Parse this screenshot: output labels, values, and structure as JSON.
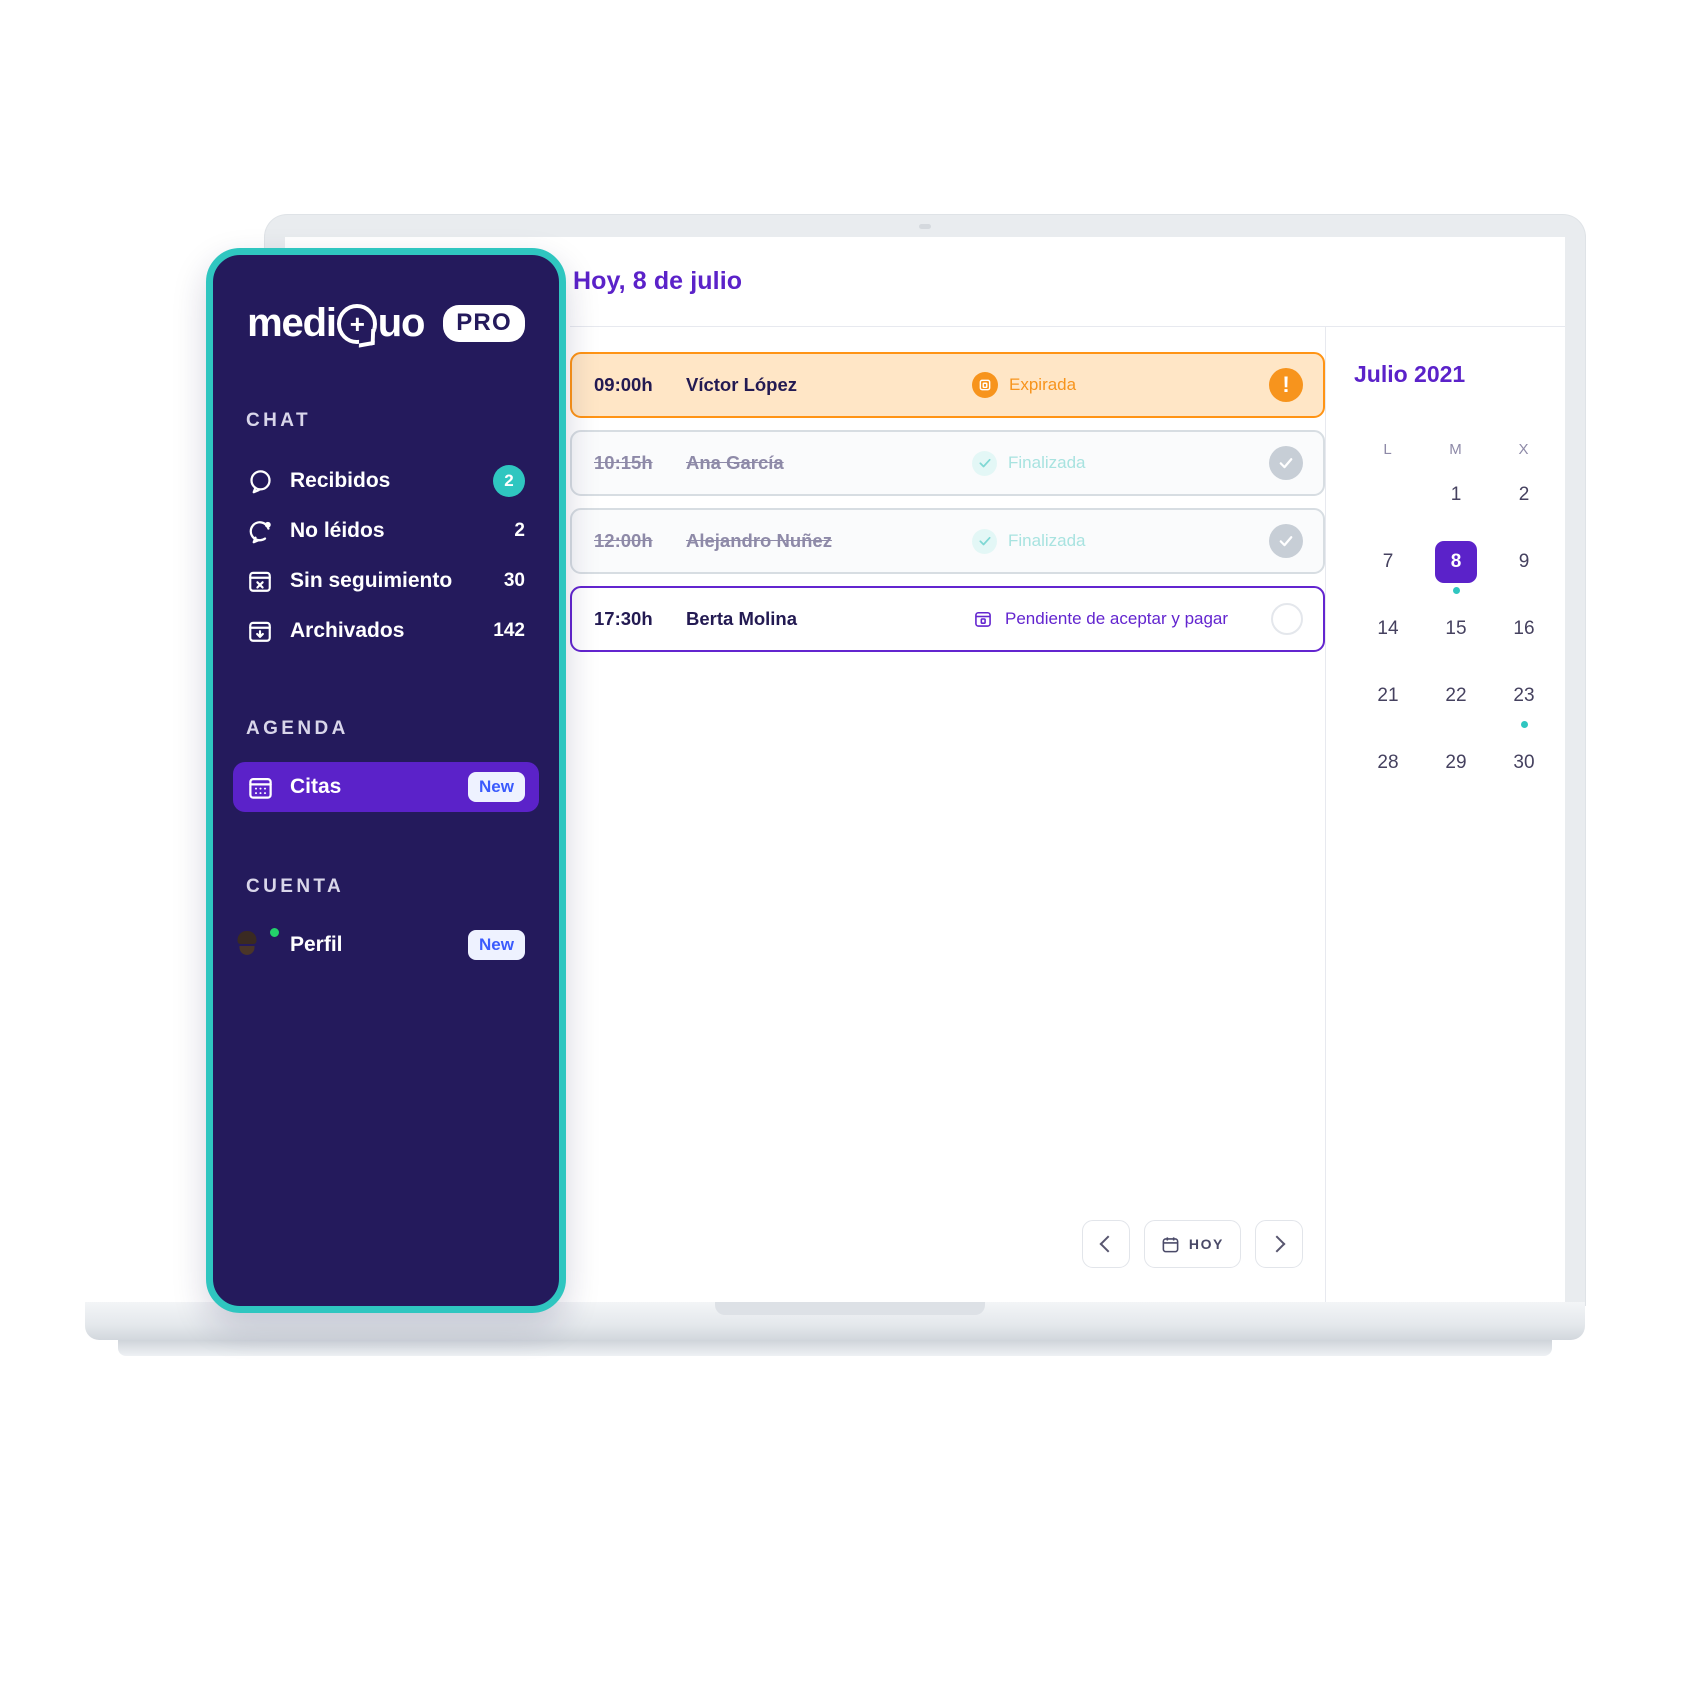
{
  "sidebar": {
    "logo": {
      "brand": "mediQuo",
      "brand_pre": "medi",
      "brand_post": "uo",
      "plus": "+",
      "suffix": "PRO"
    },
    "sections": [
      {
        "label": "CHAT"
      },
      {
        "label": "AGENDA"
      },
      {
        "label": "CUENTA"
      }
    ],
    "chat_items": [
      {
        "label": "Recibidos",
        "count": "2",
        "badge": "pill",
        "icon": "chat-bubble-icon"
      },
      {
        "label": "No léidos",
        "count": "2",
        "badge": "plain",
        "icon": "chat-unread-icon"
      },
      {
        "label": "Sin seguimiento",
        "count": "30",
        "badge": "plain",
        "icon": "calendar-x-icon"
      },
      {
        "label": "Archivados",
        "count": "142",
        "badge": "plain",
        "icon": "archive-icon"
      }
    ],
    "agenda_items": [
      {
        "label": "Citas",
        "badge": "New",
        "icon": "calendar-icon",
        "active": true
      }
    ],
    "account_items": [
      {
        "label": "Perfil",
        "badge": "New",
        "icon": "avatar-icon"
      }
    ]
  },
  "header": {
    "title": "Hoy, 8 de julio"
  },
  "appointments": [
    {
      "time": "09:00h",
      "name": "Víctor López",
      "status": "Expirada",
      "state": "expired",
      "status_icon": "calendar-filled-icon",
      "end_icon": "warning-icon"
    },
    {
      "time": "10:15h",
      "name": "Ana García",
      "status": "Finalizada",
      "state": "done",
      "status_icon": "check-icon",
      "end_icon": "check-circle-icon"
    },
    {
      "time": "12:00h",
      "name": "Alejandro Nuñez",
      "status": "Finalizada",
      "state": "done",
      "status_icon": "check-icon",
      "end_icon": "check-circle-icon"
    },
    {
      "time": "17:30h",
      "name": "Berta Molina",
      "status": "Pendiente de aceptar y pagar",
      "state": "pending",
      "status_icon": "calendar-outline-icon",
      "end_icon": "empty-circle-icon"
    }
  ],
  "bottom_nav": {
    "prev_label": "‹",
    "next_label": "›",
    "today_label": "HOY",
    "today_icon": "calendar-icon"
  },
  "calendar": {
    "title": "Julio 2021",
    "dow": [
      "L",
      "M",
      "X"
    ],
    "weeks": [
      [
        {
          "day": "",
          "sel": false,
          "dot": false
        },
        {
          "day": "1",
          "sel": false,
          "dot": false
        },
        {
          "day": "2",
          "sel": false,
          "dot": false
        }
      ],
      [
        {
          "day": "7",
          "sel": false,
          "dot": false
        },
        {
          "day": "8",
          "sel": true,
          "dot": true
        },
        {
          "day": "9",
          "sel": false,
          "dot": false
        }
      ],
      [
        {
          "day": "14",
          "sel": false,
          "dot": false
        },
        {
          "day": "15",
          "sel": false,
          "dot": false
        },
        {
          "day": "16",
          "sel": false,
          "dot": false
        }
      ],
      [
        {
          "day": "21",
          "sel": false,
          "dot": false
        },
        {
          "day": "22",
          "sel": false,
          "dot": false
        },
        {
          "day": "23",
          "sel": false,
          "dot": true
        }
      ],
      [
        {
          "day": "28",
          "sel": false,
          "dot": false
        },
        {
          "day": "29",
          "sel": false,
          "dot": false
        },
        {
          "day": "30",
          "sel": false,
          "dot": false
        }
      ]
    ]
  },
  "colors": {
    "sidebar_bg": "#241a5c",
    "accent_teal": "#2fc6c0",
    "accent_purple": "#5b22c9",
    "expired_orange": "#f7941d",
    "expired_bg": "#ffe6c6"
  }
}
